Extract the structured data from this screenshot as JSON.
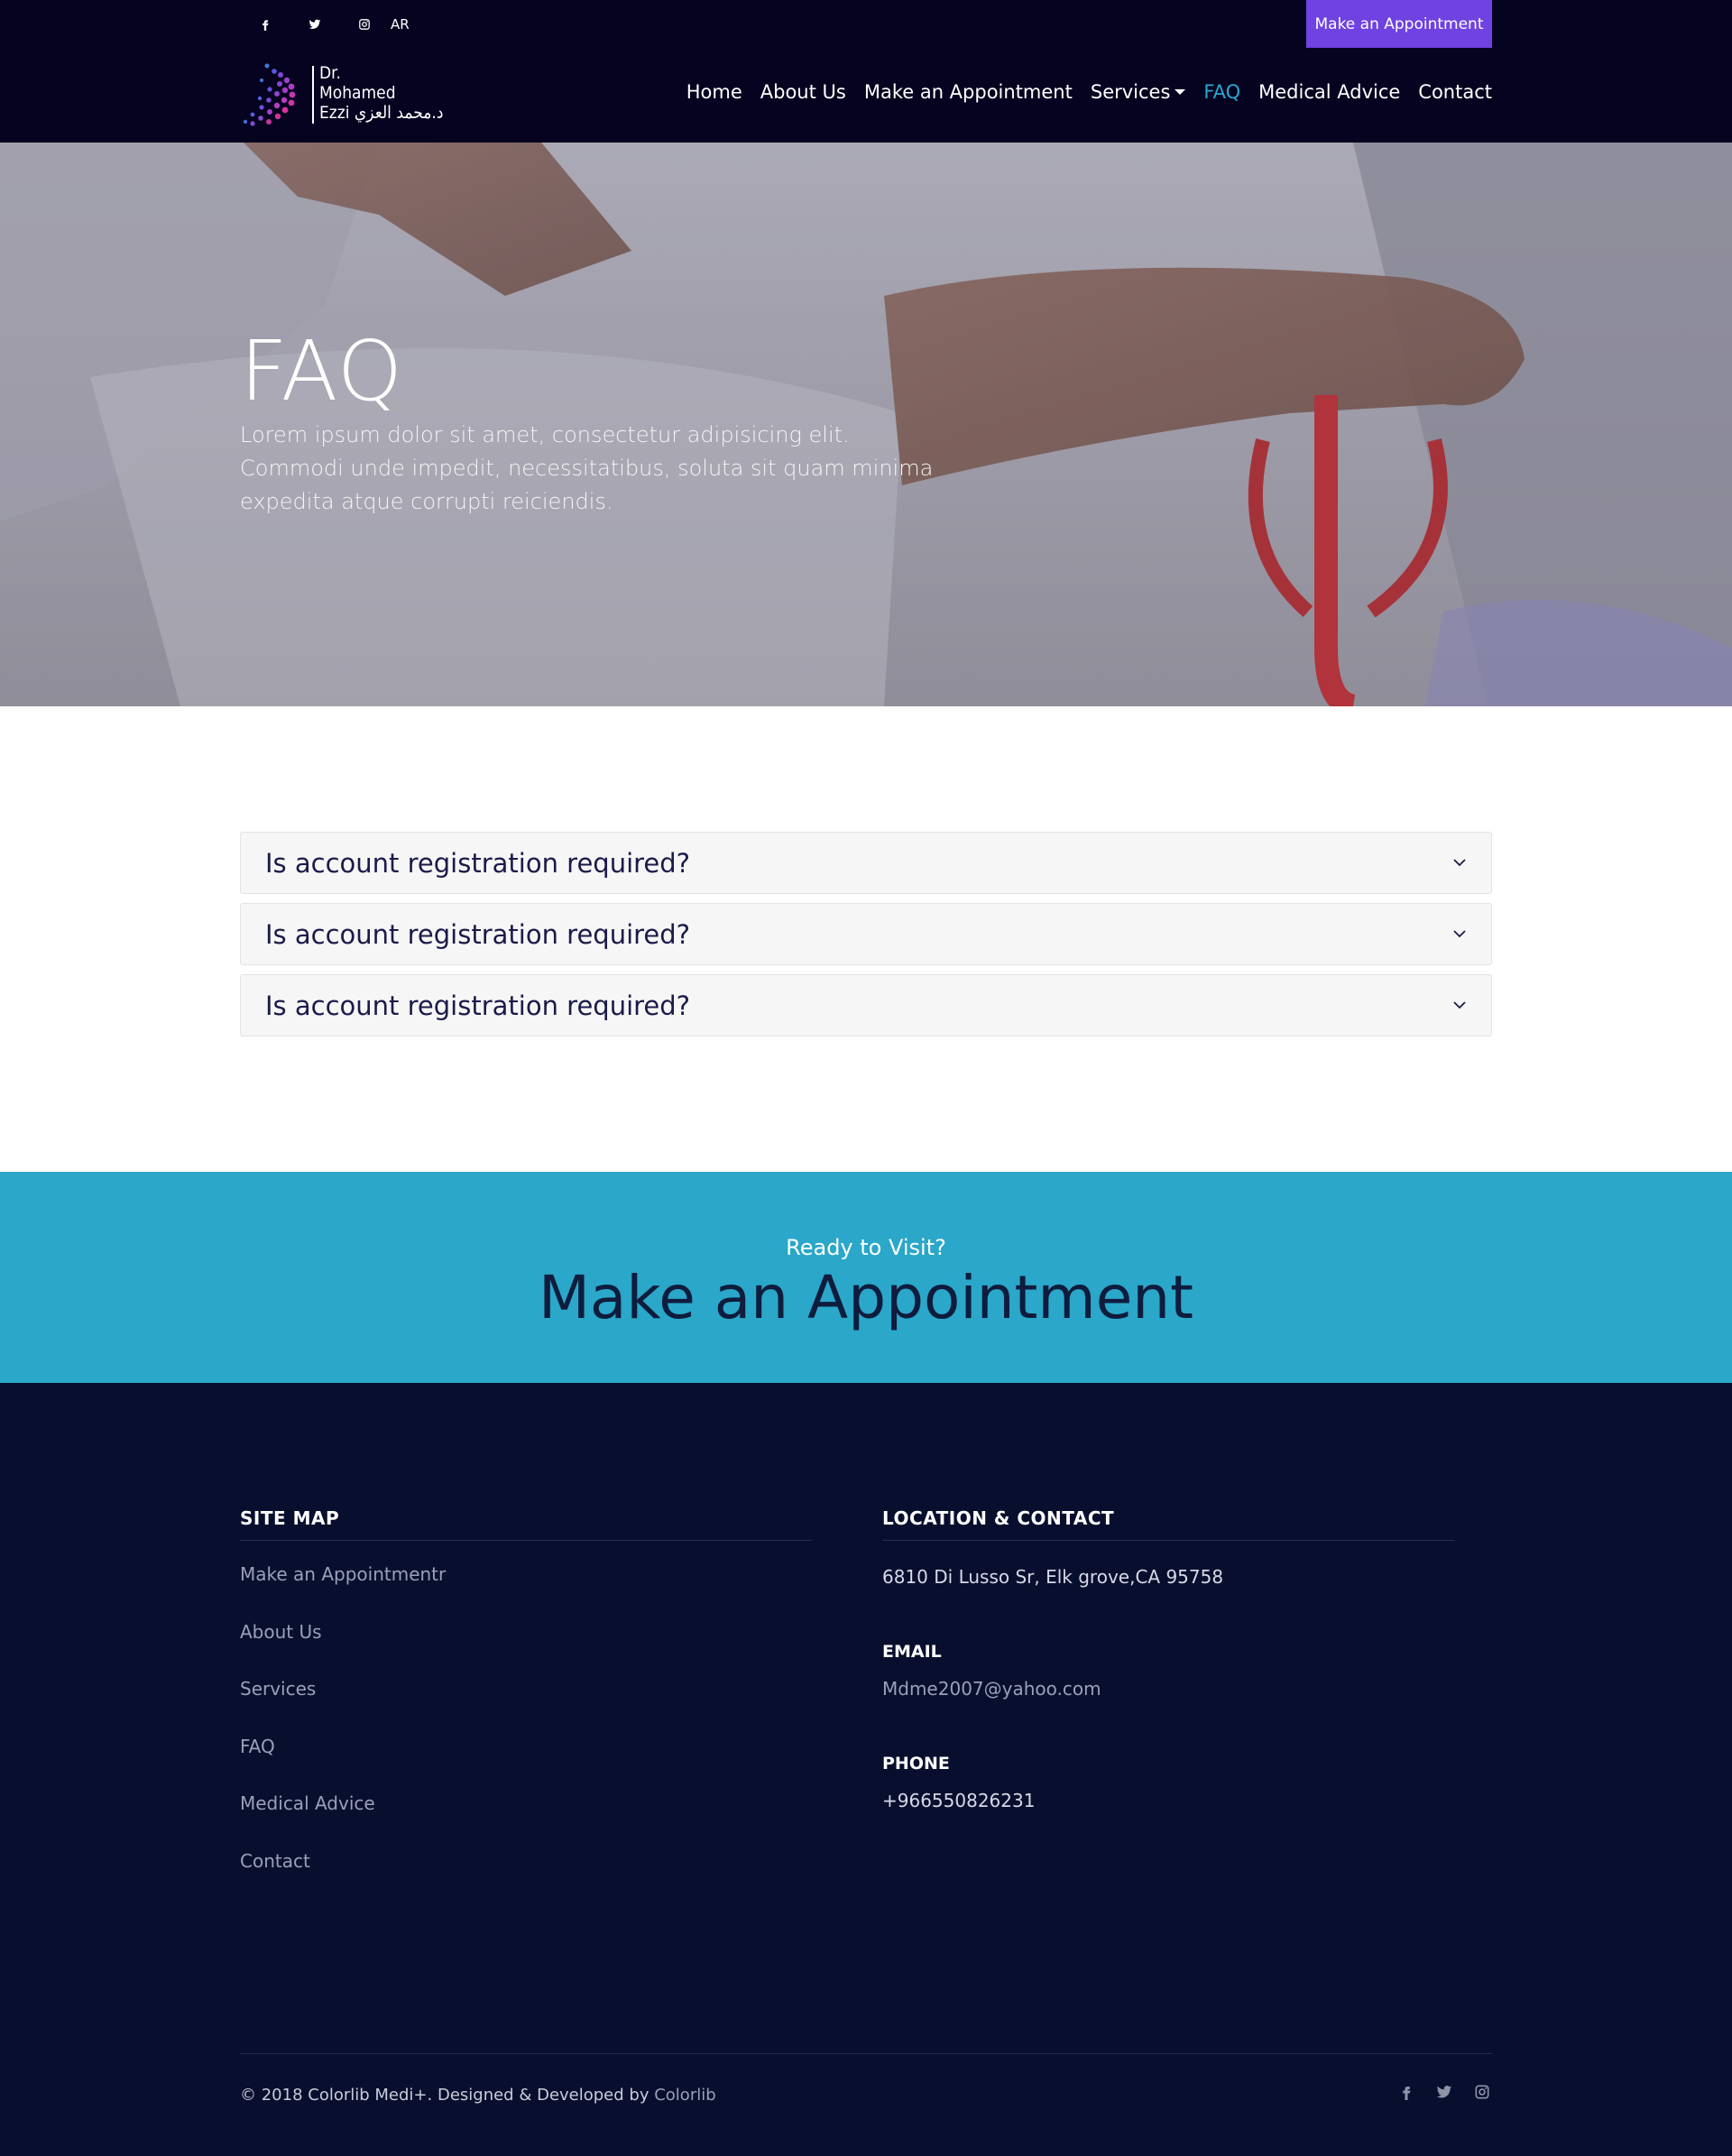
{
  "topbar": {
    "social": [
      "facebook-icon",
      "twitter-icon",
      "instagram-icon"
    ],
    "lang": "AR",
    "cta": "Make an Appointment",
    "cta_color": "#6f42e1"
  },
  "logo": {
    "line1": "Dr.",
    "line2": "Mohamed",
    "line3": "Ezzi د.محمد العزي"
  },
  "nav": {
    "items": [
      {
        "label": "Home"
      },
      {
        "label": "About Us"
      },
      {
        "label": "Make an Appointment"
      },
      {
        "label": "Services"
      },
      {
        "label": "FAQ"
      },
      {
        "label": "Medical Advice"
      },
      {
        "label": "Contact"
      }
    ],
    "active": "FAQ",
    "active_color": "#27a9d0"
  },
  "hero": {
    "title": "FAQ",
    "subtitle": "Lorem ipsum dolor sit amet, consectetur adipisicing elit. Commodi unde impedit, necessitatibus, soluta sit quam minima expedita atque corrupti reiciendis."
  },
  "faq": {
    "items": [
      {
        "question": "Is account registration required?"
      },
      {
        "question": "Is account registration required?"
      },
      {
        "question": "Is account registration required?"
      }
    ]
  },
  "cta_band": {
    "kicker": "Ready to Visit?",
    "title": "Make an Appointment",
    "background": "#2aa7c9"
  },
  "footer": {
    "sitemap": {
      "heading": "SITE MAP",
      "links": [
        "Make an Appointmentr",
        "About Us",
        "Services",
        "FAQ",
        "Medical Advice",
        "Contact"
      ]
    },
    "contact": {
      "heading": "LOCATION & CONTACT",
      "address": "6810 Di Lusso Sr, Elk grove,CA 95758",
      "email_label": "EMAIL",
      "email": "Mdme2007@yahoo.com",
      "phone_label": "PHONE",
      "phone": "+966550826231"
    },
    "copyright": "© 2018 Colorlib Medi+. Designed & Developed by",
    "copyright_brand": "Colorlib",
    "social": [
      "facebook-icon",
      "twitter-icon",
      "instagram-icon"
    ]
  }
}
